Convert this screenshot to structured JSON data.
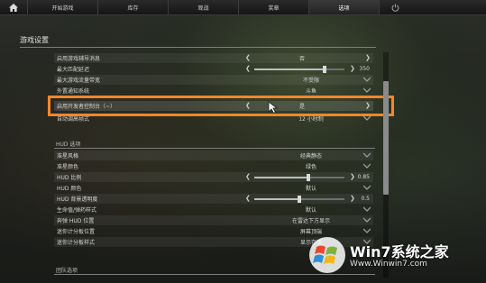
{
  "nav": {
    "tabs": [
      {
        "label": "开始游戏"
      },
      {
        "label": "库存"
      },
      {
        "label": "观战"
      },
      {
        "label": "奖章"
      },
      {
        "label": "选项"
      }
    ],
    "home_icon": "home-icon",
    "power_icon": "power-icon"
  },
  "page": {
    "title": "游戏设置"
  },
  "settings": [
    {
      "label": "启用游戏辅导消息",
      "value": "否",
      "control": "toggle"
    },
    {
      "label": "最大匹配延迟",
      "value": "350",
      "control": "slider",
      "level": 0.78
    },
    {
      "label": "最大游戏流量带宽",
      "value": "不受限",
      "control": "dropdown"
    },
    {
      "label": "外置通知系统",
      "value": "斗鱼",
      "control": "dropdown"
    },
    {
      "label": "启用开发者控制台（~）",
      "value": "是",
      "control": "toggle"
    },
    {
      "label": "自动调高帧式",
      "value": "12 小时制",
      "control": "dropdown"
    }
  ],
  "hud": {
    "title": "HUD 选项",
    "items": [
      {
        "label": "准星风格",
        "value": "经典静态",
        "control": "dropdown"
      },
      {
        "label": "准星颜色",
        "value": "绿色",
        "control": "dropdown"
      },
      {
        "label": "HUD 比例",
        "value": "0.85",
        "control": "slider",
        "level": 0.6
      },
      {
        "label": "HUD 颜色",
        "value": "默认",
        "control": "dropdown"
      },
      {
        "label": "HUD 背景透明度",
        "value": "0.5",
        "control": "slider",
        "level": 0.5
      },
      {
        "label": "生命值/弹药样式",
        "value": "默认",
        "control": "dropdown"
      },
      {
        "label": "奔弹 HUD 位置",
        "value": "在雷达下方显示",
        "control": "dropdown"
      },
      {
        "label": "迷你计分板位置",
        "value": "屏幕顶端",
        "control": "dropdown"
      },
      {
        "label": "迷你计分板样式",
        "value": "显示存活",
        "control": "dropdown"
      }
    ]
  },
  "team": {
    "title": "团队选项"
  },
  "watermark": {
    "title": "Win7系统之家",
    "url": "Www.Winwin7.com"
  },
  "colors": {
    "highlight": "#f0872d",
    "accent_text": "#d5d5d5"
  }
}
